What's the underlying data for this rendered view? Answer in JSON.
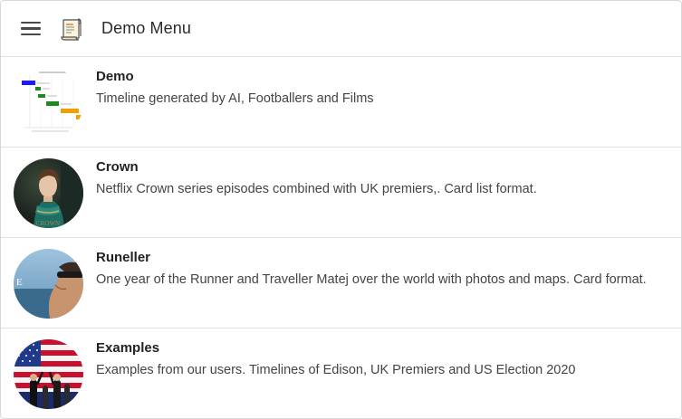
{
  "header": {
    "title": "Demo Menu",
    "menu_icon": "hamburger-menu-icon",
    "logo_icon": "scroll-icon"
  },
  "items": [
    {
      "title": "Demo",
      "description": "Timeline generated by AI, Footballers and Films",
      "thumbnail": "timeline-chart-thumbnail"
    },
    {
      "title": "Crown",
      "description": "Netflix Crown series episodes combined with UK premiers,. Card list format.",
      "thumbnail": "crown-portrait-thumbnail"
    },
    {
      "title": "Runeller",
      "description": "One year of the Runner and Traveller Matej over the world with photos and maps. Card format.",
      "thumbnail": "runner-sunglasses-thumbnail"
    },
    {
      "title": "Examples",
      "description": "Examples from our users. Timelines of Edison, UK Premiers and US Election 2020",
      "thumbnail": "us-flag-stage-thumbnail"
    }
  ],
  "colors": {
    "demo_bar_blue": "#1a1aff",
    "demo_bar_green": "#1e8a1e",
    "demo_bar_orange": "#f0a000"
  }
}
